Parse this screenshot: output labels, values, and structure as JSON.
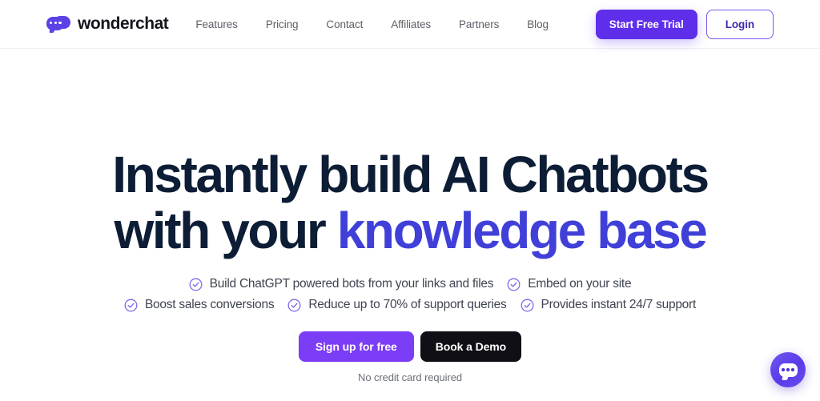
{
  "header": {
    "brand": {
      "name": "wonderchat",
      "logo_icon": "chat-bubble-dots-icon",
      "logo_color": "#5b42e6"
    },
    "nav": [
      {
        "label": "Features"
      },
      {
        "label": "Pricing"
      },
      {
        "label": "Contact"
      },
      {
        "label": "Affiliates"
      },
      {
        "label": "Partners"
      },
      {
        "label": "Blog"
      }
    ],
    "actions": {
      "trial_label": "Start Free Trial",
      "trial_color": "#5f2eea",
      "login_label": "Login",
      "login_border_color": "#7a55f0"
    }
  },
  "hero": {
    "headline_line1": "Instantly build AI Chatbots",
    "headline_line2_plain": "with your ",
    "headline_line2_accent": "knowledge base",
    "headline_color": "#0c1d35",
    "accent_color": "#4040d9",
    "features": [
      [
        {
          "icon": "check-circle-icon",
          "label": "Build ChatGPT powered bots from your links and files"
        },
        {
          "icon": "check-circle-icon",
          "label": "Embed on your site"
        }
      ],
      [
        {
          "icon": "check-circle-icon",
          "label": "Boost sales conversions"
        },
        {
          "icon": "check-circle-icon",
          "label": "Reduce up to 70% of support queries"
        },
        {
          "icon": "check-circle-icon",
          "label": "Provides instant 24/7 support"
        }
      ]
    ],
    "cta": {
      "signup_label": "Sign up for free",
      "signup_color": "#7b3df5",
      "demo_label": "Book a Demo",
      "demo_color": "#100f16"
    },
    "footnote": "No credit card required"
  },
  "chat_widget": {
    "icon": "chat-bubble-dots-icon",
    "color": "#5b3ae8"
  }
}
